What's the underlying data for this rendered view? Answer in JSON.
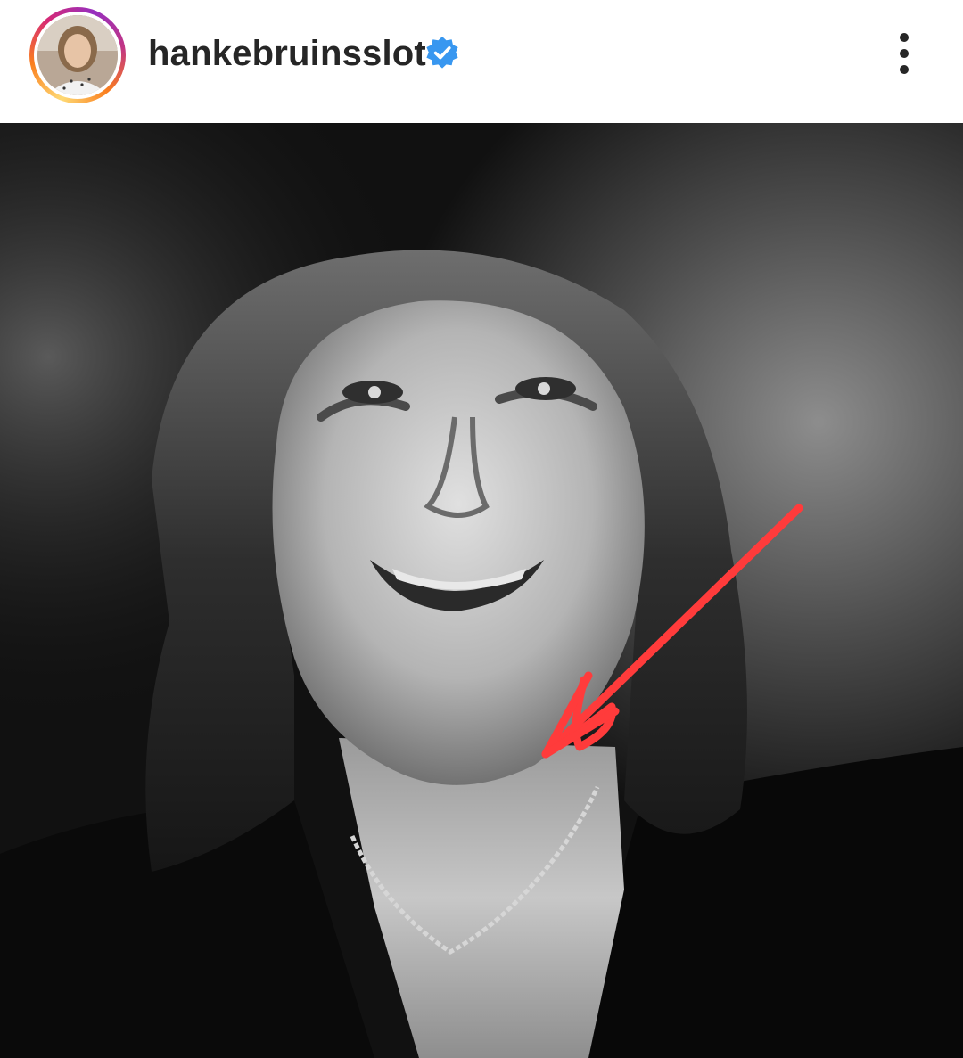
{
  "post": {
    "username": "hankebruinsslot",
    "verified": true,
    "verified_badge_color": "#3897f0",
    "story_ring_colors": [
      "#feda75",
      "#fa7e1e",
      "#d62976",
      "#962fbf"
    ],
    "header_icons": {
      "verified": "verified-badge-icon",
      "more": "more-options-icon"
    },
    "media": {
      "kind": "black-and-white portrait photo",
      "annotation_color": "#ff3b3b",
      "annotation": "red-arrow-icon"
    }
  }
}
